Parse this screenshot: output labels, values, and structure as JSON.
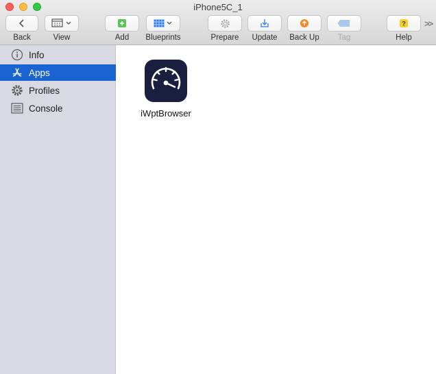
{
  "window": {
    "title": "iPhone5C_1"
  },
  "toolbar": {
    "back": {
      "label": "Back",
      "icon": "chevron-left-icon"
    },
    "view": {
      "label": "View",
      "icon": "calendar-grid-icon"
    },
    "add": {
      "label": "Add",
      "icon": "plus-icon",
      "color": "#5cc25c"
    },
    "blueprints": {
      "label": "Blueprints",
      "icon": "blueprint-grid-icon",
      "color": "#2b7de9"
    },
    "prepare": {
      "label": "Prepare",
      "icon": "gear-icon"
    },
    "update": {
      "label": "Update",
      "icon": "download-tray-icon",
      "color": "#2f7fe0"
    },
    "backup": {
      "label": "Back Up",
      "icon": "upload-circle-icon",
      "color": "#f08a24"
    },
    "tag": {
      "label": "Tag",
      "icon": "tag-icon",
      "color": "#a8c8ef"
    },
    "help": {
      "label": "Help",
      "icon": "question-icon",
      "color": "#f3cf2c"
    },
    "overflow": {
      "label": ">>"
    }
  },
  "sidebar": {
    "items": [
      {
        "label": "Info",
        "icon": "info-icon",
        "selected": false
      },
      {
        "label": "Apps",
        "icon": "app-store-icon",
        "selected": true
      },
      {
        "label": "Profiles",
        "icon": "gear-icon",
        "selected": false
      },
      {
        "label": "Console",
        "icon": "console-icon",
        "selected": false
      }
    ],
    "selected_color": "#1a64d1"
  },
  "content": {
    "apps": [
      {
        "name": "iWptBrowser",
        "icon": "speedometer-icon"
      }
    ]
  }
}
